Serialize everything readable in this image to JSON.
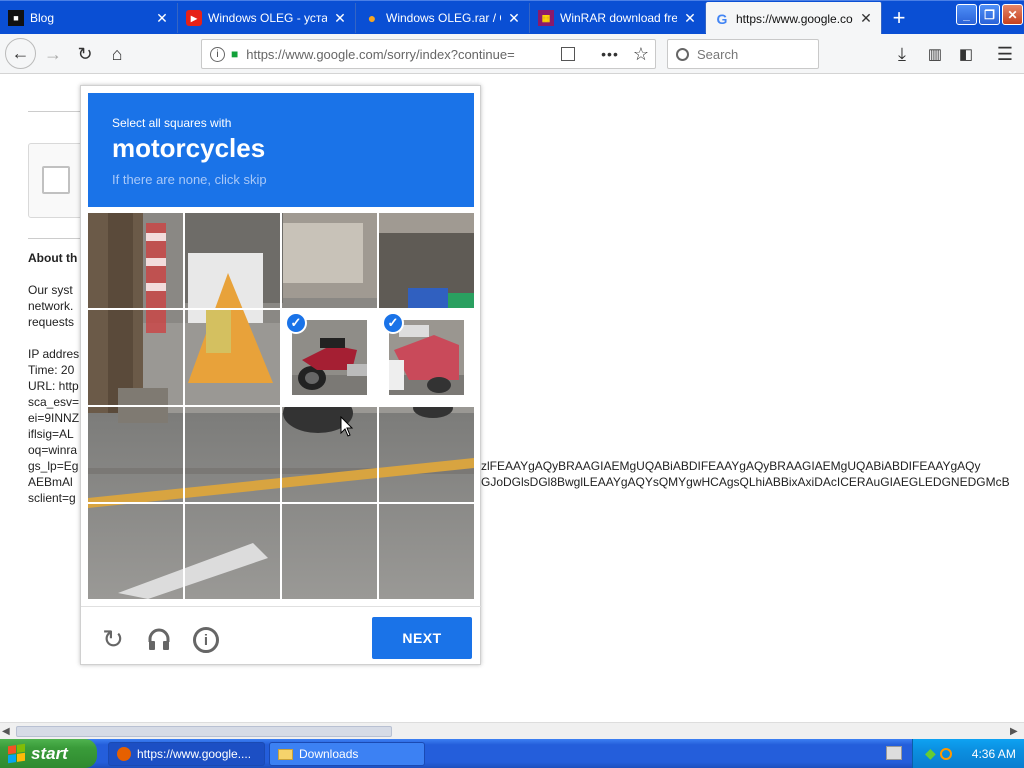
{
  "browser": {
    "tabs": [
      {
        "title": "Blog",
        "icon": "blog-icon",
        "active": false
      },
      {
        "title": "Windows OLEG - устан",
        "icon": "youtube-icon",
        "active": false
      },
      {
        "title": "Windows OLEG.rar / Об",
        "icon": "cloud-icon",
        "active": false
      },
      {
        "title": "WinRAR download free",
        "icon": "winrar-icon",
        "active": false
      },
      {
        "title": "https://www.google.co",
        "icon": "google-icon",
        "active": true
      }
    ],
    "new_tab": "+",
    "url": "https://www.google.com/sorry/index?continue=",
    "search_placeholder": "Search"
  },
  "page": {
    "about_heading": "About th",
    "lines": [
      "Our syst",
      "network.",
      "requests",
      "",
      "IP addres",
      "Time: 20",
      "URL: http",
      "sca_esv=",
      "ei=9INNZ",
      "iflsig=AL",
      "oq=winra",
      "gs_lp=Eg",
      "AEBmAl",
      "sclient=g"
    ],
    "gs_lp_tail_1": "zlFEAAYgAQyBRAAGIAEMgUQABiABDIFEAAYgAQyBRAAGIAEMgUQABiABDIFEAAYgAQy",
    "gs_lp_tail_2": "GJoDGlsDGl8BwglLEAAYgAQYsQMYgwHCAgsQLhiABBixAxiDAcICERAuGIAEGLEDGNEDGMcB"
  },
  "captcha": {
    "instruction": "Select all squares with",
    "target": "motorcycles",
    "hint": "If there are none, click skip",
    "selected_cells": [
      6,
      7
    ],
    "next_label": "NEXT",
    "footer_icons": [
      "reload-icon",
      "audio-icon",
      "info-icon"
    ]
  },
  "taskbar": {
    "start_label": "start",
    "items": [
      "https://www.google....",
      "Downloads"
    ],
    "clock": "4:36 AM"
  },
  "colors": {
    "captcha_blue": "#1a73e8",
    "xp_blue": "#245edb",
    "start_green": "#3a9c3a"
  }
}
